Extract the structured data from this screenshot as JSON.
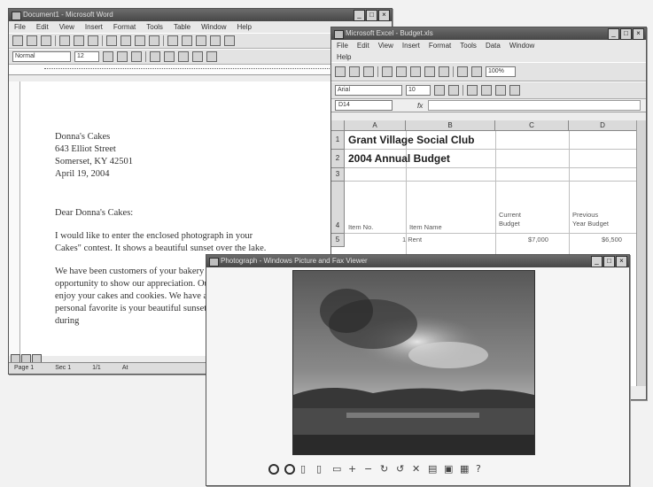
{
  "word": {
    "title": "Document1 - Microsoft Word",
    "menu": [
      "File",
      "Edit",
      "View",
      "Insert",
      "Format",
      "Tools",
      "Table",
      "Window",
      "Help"
    ],
    "style_label": "Normal",
    "size_label": "12",
    "address": [
      "Donna's Cakes",
      "643 Elliot Street",
      "Somerset, KY 42501",
      "April 19, 2004"
    ],
    "salutation": "Dear Donna's Cakes:",
    "para1": [
      "I would like to enter the enclosed photograph in your",
      "Cakes\" contest. It shows a beautiful sunset over the lake."
    ],
    "para2": [
      "We have been customers of your bakery for years and this",
      "opportunity to show our appreciation. Our family and friends",
      "enjoy your cakes and cookies. We have attached our entry",
      "personal favorite is your beautiful sunset cake, which we enjoy",
      "during"
    ],
    "status": [
      "Page 1",
      "Sec 1",
      "1/1",
      "At"
    ]
  },
  "excel": {
    "title": "Microsoft Excel - Budget.xls",
    "menu": [
      "File",
      "Edit",
      "View",
      "Insert",
      "Format",
      "Tools",
      "Data",
      "Window",
      "Help"
    ],
    "font_label": "Arial",
    "size_label": "10",
    "zoom": "100%",
    "namebox": "D14",
    "fx": "fx",
    "columns": [
      "A",
      "B",
      "C",
      "D"
    ],
    "rows": [
      "1",
      "2",
      "3",
      "4",
      "5"
    ],
    "cells": {
      "a1": "Grant Village Social Club",
      "a2": "2004 Annual Budget",
      "c4": [
        "Current",
        "Budget"
      ],
      "d4": [
        "Previous",
        "Year Budget"
      ],
      "a4": "Item No.",
      "b4": "Item Name",
      "b5": "1 Rent",
      "c5": "$7,000",
      "d5": "$6,500"
    }
  },
  "player": {
    "title": "Photograph - Windows Picture and Fax Viewer"
  }
}
